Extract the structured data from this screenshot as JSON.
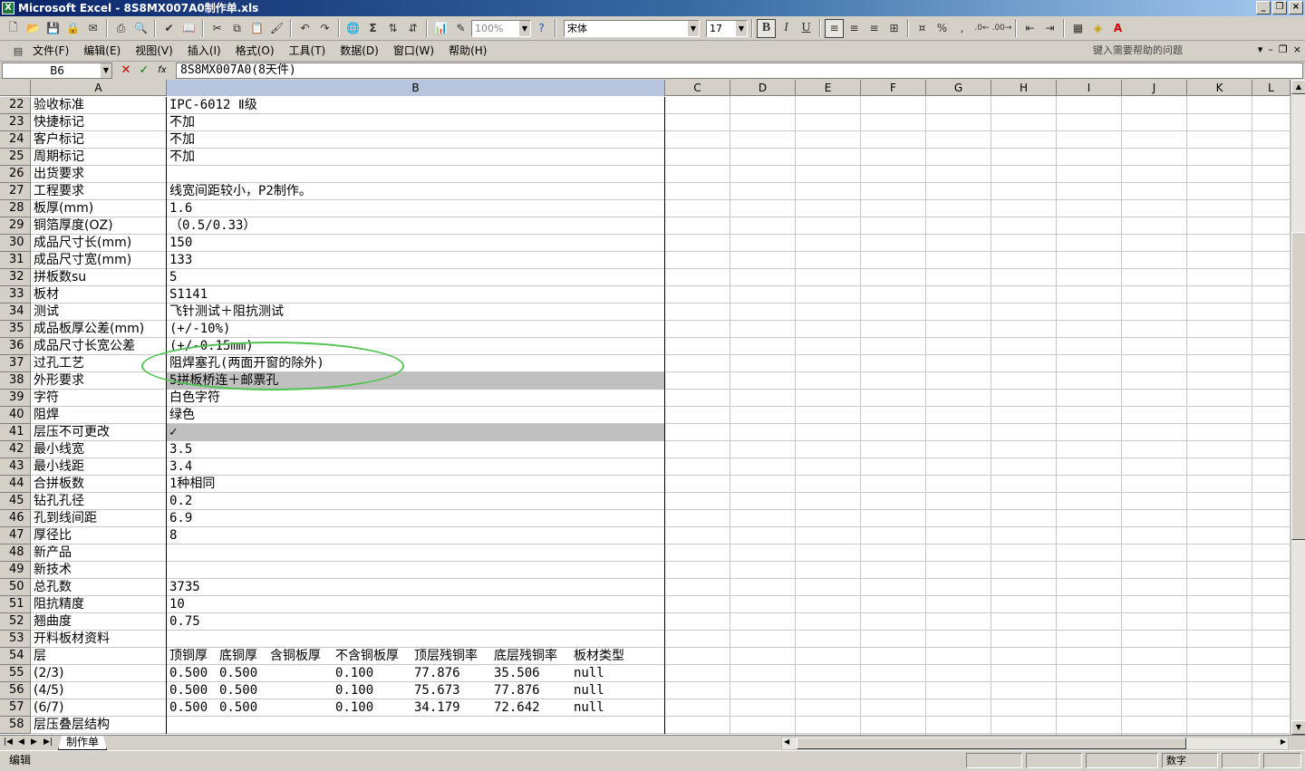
{
  "window": {
    "title": "Microsoft Excel - 8S8MX007A0制作单.xls",
    "icon": "excel-icon"
  },
  "toolbar": {
    "zoom": "100%",
    "font_name": "宋体",
    "font_size": "17",
    "bold_label": "B",
    "italic_label": "I",
    "underline_label": "U",
    "sum_label": "Σ",
    "percent_label": "%",
    "comma_label": ","
  },
  "menu": {
    "items": [
      "文件(F)",
      "编辑(E)",
      "视图(V)",
      "插入(I)",
      "格式(O)",
      "工具(T)",
      "数据(D)",
      "窗口(W)",
      "帮助(H)"
    ],
    "help_placeholder": "键入需要帮助的问题"
  },
  "formula": {
    "cell_ref": "B6",
    "content": "8S8MX007A0(8天件)",
    "fx_label": "fx"
  },
  "columns": [
    "A",
    "B",
    "C",
    "D",
    "E",
    "F",
    "G",
    "H",
    "I",
    "J",
    "K",
    "L"
  ],
  "rows": [
    {
      "n": "22",
      "a": "验收标准",
      "b": "IPC-6012 Ⅱ级"
    },
    {
      "n": "23",
      "a": "快捷标记",
      "b": "不加"
    },
    {
      "n": "24",
      "a": "客户标记",
      "b": "不加"
    },
    {
      "n": "25",
      "a": "周期标记",
      "b": "不加"
    },
    {
      "n": "26",
      "a": "出货要求",
      "b": ""
    },
    {
      "n": "27",
      "a": "工程要求",
      "b": "线宽间距较小，P2制作。"
    },
    {
      "n": "28",
      "a": "板厚(mm)",
      "b": "1.6"
    },
    {
      "n": "29",
      "a": "铜箔厚度(OZ)",
      "b": "（0.5/0.33）"
    },
    {
      "n": "30",
      "a": "成品尺寸长(mm)",
      "b": "150"
    },
    {
      "n": "31",
      "a": "成品尺寸宽(mm)",
      "b": "133"
    },
    {
      "n": "32",
      "a": "拼板数su",
      "b": "5"
    },
    {
      "n": "33",
      "a": "板材",
      "b": "S1141"
    },
    {
      "n": "34",
      "a": "测试",
      "b": "飞针测试＋阻抗测试"
    },
    {
      "n": "35",
      "a": "成品板厚公差(mm)",
      "b": "(+/-10%)"
    },
    {
      "n": "36",
      "a": "成品尺寸长宽公差",
      "b": "(+/-0.15mm)"
    },
    {
      "n": "37",
      "a": "过孔工艺",
      "b": "阻焊塞孔(两面开窗的除外)"
    },
    {
      "n": "38",
      "a": "外形要求",
      "b": "5拼板桥连＋邮票孔"
    },
    {
      "n": "39",
      "a": "字符",
      "b": "白色字符"
    },
    {
      "n": "40",
      "a": "阻焊",
      "b": "绿色"
    },
    {
      "n": "41",
      "a": "层压不可更改",
      "b": "✓"
    },
    {
      "n": "42",
      "a": "最小线宽",
      "b": "3.5"
    },
    {
      "n": "43",
      "a": "最小线距",
      "b": "3.4"
    },
    {
      "n": "44",
      "a": "合拼板数",
      "b": "1种相同"
    },
    {
      "n": "45",
      "a": "钻孔孔径",
      "b": "0.2"
    },
    {
      "n": "46",
      "a": "孔到线间距",
      "b": "6.9"
    },
    {
      "n": "47",
      "a": "厚径比",
      "b": "8"
    },
    {
      "n": "48",
      "a": "新产品",
      "b": ""
    },
    {
      "n": "49",
      "a": "新技术",
      "b": ""
    },
    {
      "n": "50",
      "a": "总孔数",
      "b": "3735"
    },
    {
      "n": "51",
      "a": "阻抗精度",
      "b": "10"
    },
    {
      "n": "52",
      "a": "翘曲度",
      "b": "0.75"
    },
    {
      "n": "53",
      "a": "开料板材资料",
      "b": ""
    }
  ],
  "layer_header": {
    "n": "54",
    "a": "层",
    "cols": [
      "顶铜厚",
      "底铜厚",
      "含铜板厚",
      "不含铜板厚",
      "顶层残铜率",
      "底层残铜率",
      "板材类型"
    ]
  },
  "layer_rows": [
    {
      "n": "55",
      "a": "(2/3)",
      "vals": [
        "0.500",
        "0.500",
        "",
        "0.100",
        "77.876",
        "35.506",
        "null"
      ]
    },
    {
      "n": "56",
      "a": "(4/5)",
      "vals": [
        "0.500",
        "0.500",
        "",
        "0.100",
        "75.673",
        "77.876",
        "null"
      ]
    },
    {
      "n": "57",
      "a": "(6/7)",
      "vals": [
        "0.500",
        "0.500",
        "",
        "0.100",
        "34.179",
        "72.642",
        "null"
      ]
    }
  ],
  "last_row": {
    "n": "58",
    "a": "层压叠层结构",
    "b": ""
  },
  "sheet_tab": "制作单",
  "status": {
    "mode": "编辑",
    "numlock": "数字"
  },
  "colors": {
    "highlight_ellipse": "#4fc24f",
    "gray_fill": "#c0c0c0",
    "title_blue": "#0a246a"
  }
}
